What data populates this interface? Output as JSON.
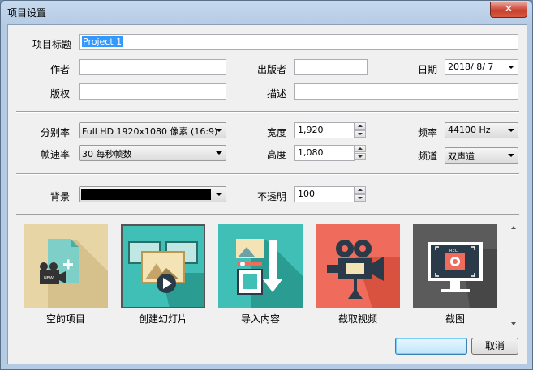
{
  "window": {
    "title": "项目设置",
    "close_symbol": "✕"
  },
  "project_title": {
    "label": "项目标题",
    "value": "Project 1"
  },
  "author": {
    "label": "作者",
    "value": ""
  },
  "publisher": {
    "label": "出版者",
    "value": ""
  },
  "date": {
    "label": "日期",
    "value": "2018/  8/  7"
  },
  "copyright": {
    "label": "版权",
    "value": ""
  },
  "description": {
    "label": "描述",
    "value": ""
  },
  "resolution": {
    "label": "分别率",
    "value": "Full HD 1920x1080 像素 (16:9)"
  },
  "width": {
    "label": "宽度",
    "value": "1,920"
  },
  "frequency": {
    "label": "频率",
    "value": "44100 Hz"
  },
  "framerate": {
    "label": "帧速率",
    "value": "30 每秒帧数"
  },
  "height": {
    "label": "高度",
    "value": "1,080"
  },
  "channel": {
    "label": "频道",
    "value": "双声道"
  },
  "background": {
    "label": "背景",
    "color": "#000000"
  },
  "opacity": {
    "label": "不透明",
    "value": "100"
  },
  "templates": [
    {
      "label": "空的项目",
      "icon": "new-project-icon",
      "color": "#e8d5a6"
    },
    {
      "label": "创建幻灯片",
      "icon": "slideshow-icon",
      "color": "#3fbfb5"
    },
    {
      "label": "导入内容",
      "icon": "import-content-icon",
      "color": "#3fbfb5"
    },
    {
      "label": "截取视频",
      "icon": "capture-video-icon",
      "color": "#ef6b5b"
    },
    {
      "label": "截图",
      "icon": "screenshot-icon",
      "color": "#5b5b5b"
    }
  ],
  "buttons": {
    "ok": "",
    "cancel": "取消"
  }
}
